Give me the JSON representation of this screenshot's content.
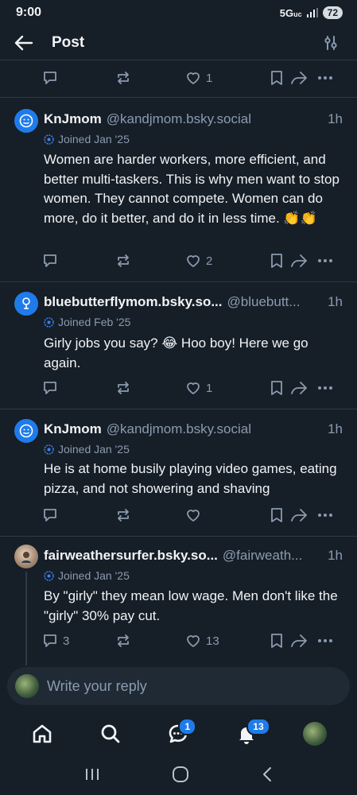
{
  "status_bar": {
    "time": "9:00",
    "network": "5G",
    "network_sub": "uc",
    "battery": "72"
  },
  "header": {
    "title": "Post"
  },
  "top_actions": {
    "likes": "1"
  },
  "posts": [
    {
      "display_name": "KnJmom",
      "handle": "@kandjmom.bsky.social",
      "time": "1h",
      "joined": "Joined Jan '25",
      "text": "Women are harder workers, more efficient, and better multi-taskers.  This is why men want to stop women.  They cannot compete. Women can do more, do it better, and do it in less time. 👏👏",
      "replies": "",
      "likes": "2"
    },
    {
      "display_name": "bluebutterflymom.bsky.so...",
      "handle": "@bluebutt...",
      "time": "1h",
      "joined": "Joined Feb '25",
      "text": "Girly jobs you say? 😂 Hoo boy! Here we go again.",
      "replies": "",
      "likes": "1"
    },
    {
      "display_name": "KnJmom",
      "handle": "@kandjmom.bsky.social",
      "time": "1h",
      "joined": "Joined Jan '25",
      "text": "He is at home busily playing video games, eating pizza, and not showering and shaving",
      "replies": "",
      "likes": ""
    },
    {
      "display_name": "fairweathersurfer.bsky.so...",
      "handle": "@fairweath...",
      "time": "1h",
      "joined": "Joined Jan '25",
      "text": "By \"girly\" they mean low wage. Men don't like the \"girly\" 30% pay cut.",
      "replies": "3",
      "likes": "13"
    }
  ],
  "reply_bar": {
    "placeholder": "Write your reply"
  },
  "bottom_nav": {
    "chat_badge": "1",
    "notifications_badge": "13"
  },
  "colors": {
    "background": "#161e27",
    "accent": "#1f7bea",
    "muted": "#8a9bb0",
    "divider": "#2e3a46"
  }
}
